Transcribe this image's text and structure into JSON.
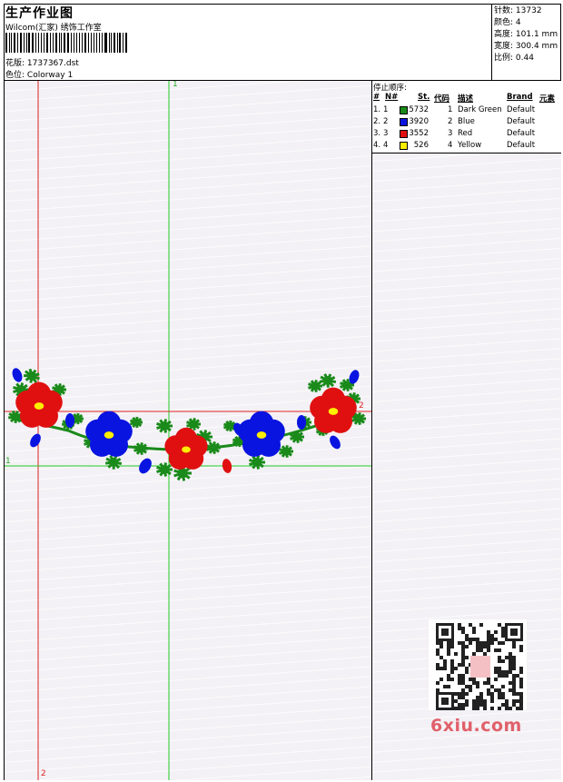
{
  "header": {
    "title": "生产作业图",
    "studio": "Wilcom(汇家) 绣饰工作室",
    "design_label": "花版:",
    "design_file": "1737367.dst",
    "colorway_label": "色位:",
    "colorway": "Colorway 1"
  },
  "stats": {
    "stitches_label": "针数:",
    "stitches": "13732",
    "colors_label": "颜色:",
    "colors": "4",
    "height_label": "高度:",
    "height": "101.1 mm",
    "width_label": "宽度:",
    "width": "300.4 mm",
    "scale_label": "比例:",
    "scale": "0.44"
  },
  "stop_sequence": {
    "title": "停止顺序:",
    "headers": [
      "#",
      "N#",
      "St.",
      "代码",
      "描述",
      "Brand",
      "元素"
    ],
    "rows": [
      {
        "num": "1.",
        "needle": "1",
        "color": "#1a8a1a",
        "stitches": "5732",
        "code": "1",
        "desc": "Dark Green",
        "brand": "Default"
      },
      {
        "num": "2.",
        "needle": "2",
        "color": "#0a14e0",
        "stitches": "3920",
        "code": "2",
        "desc": "Blue",
        "brand": "Default"
      },
      {
        "num": "3.",
        "needle": "3",
        "color": "#e01010",
        "stitches": "3552",
        "code": "3",
        "desc": "Red",
        "brand": "Default"
      },
      {
        "num": "4.",
        "needle": "4",
        "color": "#ffef00",
        "stitches": "526",
        "code": "4",
        "desc": "Yellow",
        "brand": "Default"
      }
    ]
  },
  "guides": {
    "label_1": "1",
    "label_2": "2"
  },
  "colors": {
    "green": "#1a8a1a",
    "blue": "#0a14e0",
    "red": "#e01010",
    "yellow": "#ffef00",
    "guide_green": "#22cc22",
    "guide_red": "#dd2222",
    "watermark": "#e0606a"
  },
  "watermark": {
    "text": "6xiu.com"
  }
}
